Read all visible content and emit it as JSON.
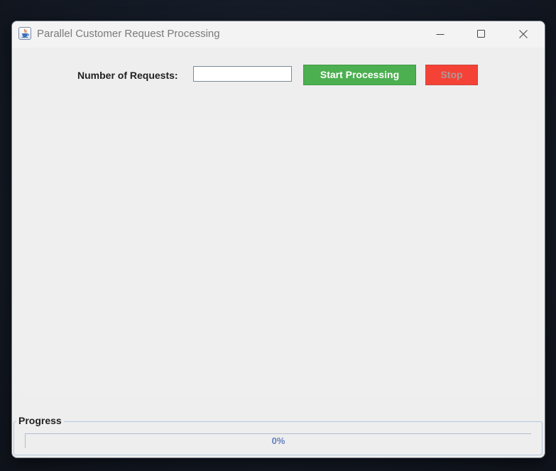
{
  "window": {
    "title": "Parallel Customer Request Processing",
    "icon": "java-icon"
  },
  "controls": {
    "requests_label": "Number of Requests:",
    "requests_value": "",
    "start_label": "Start Processing",
    "stop_label": "Stop",
    "stop_enabled": false
  },
  "progress": {
    "title": "Progress",
    "percent_text": "0%",
    "fraction": 0
  },
  "colors": {
    "start_button": "#4caf50",
    "stop_button": "#f44336",
    "progress_text": "#6382bf"
  }
}
